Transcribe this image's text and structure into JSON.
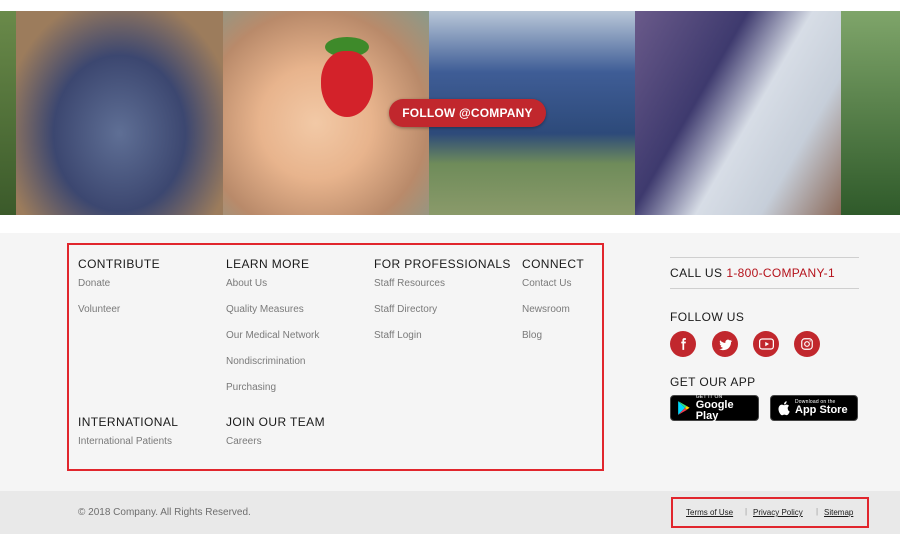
{
  "hero": {
    "follow_button": "FOLLOW @COMPANY"
  },
  "footer": {
    "columns": [
      {
        "heading": "CONTRIBUTE",
        "links": [
          "Donate",
          "Volunteer"
        ]
      },
      {
        "heading": "LEARN MORE",
        "links": [
          "About Us",
          "Quality Measures",
          "Our Medical Network",
          "Nondiscrimination",
          "Purchasing"
        ]
      },
      {
        "heading": "FOR PROFESSIONALS",
        "links": [
          "Staff Resources",
          "Staff Directory",
          "Staff Login"
        ]
      },
      {
        "heading": "CONNECT",
        "links": [
          "Contact Us",
          "Newsroom",
          "Blog"
        ]
      },
      {
        "heading": "INTERNATIONAL",
        "links": [
          "International Patients"
        ]
      },
      {
        "heading": "JOIN OUR TEAM",
        "links": [
          "Careers"
        ]
      }
    ],
    "call_us": {
      "label": "CALL US",
      "phone": "1-800-COMPANY-1"
    },
    "follow_us": {
      "heading": "FOLLOW US",
      "icons": [
        "facebook-icon",
        "twitter-icon",
        "youtube-icon",
        "instagram-icon"
      ]
    },
    "get_app": {
      "heading": "GET OUR APP",
      "google_play": {
        "small": "GET IT ON",
        "big": "Google Play"
      },
      "app_store": {
        "small": "Download on the",
        "big": "App Store"
      }
    }
  },
  "bottom": {
    "copyright": "© 2018 Company. All Rights Reserved.",
    "links": [
      "Terms of Use",
      "Privacy Policy",
      "Sitemap"
    ],
    "separator": "|"
  },
  "colors": {
    "brand_red": "#c1272d",
    "highlight_border": "#e1262d",
    "phone_red": "#b5121b"
  }
}
